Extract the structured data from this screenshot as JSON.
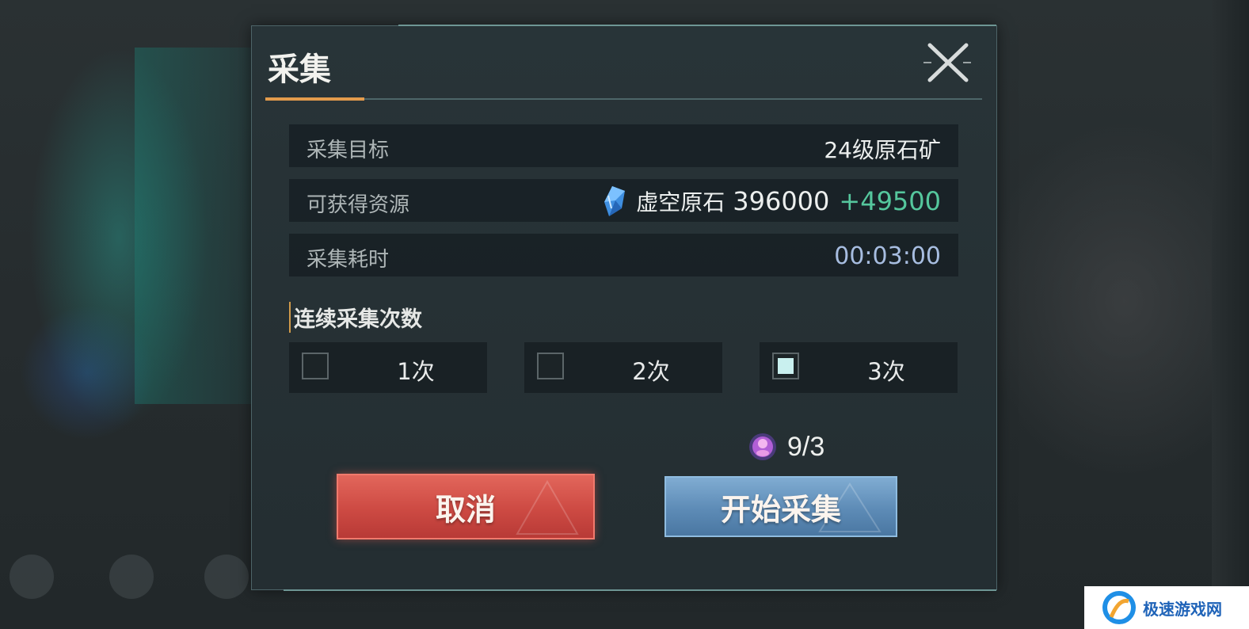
{
  "dialog": {
    "title": "采集",
    "close_icon": "close-x-icon"
  },
  "info_rows": {
    "target": {
      "label": "采集目标",
      "value": "24级原石矿"
    },
    "resource": {
      "label": "可获得资源",
      "icon": "crystal-icon",
      "name": "虚空原石",
      "amount": "396000",
      "bonus": "+49500"
    },
    "duration": {
      "label": "采集耗时",
      "value": "00:03:00"
    }
  },
  "repeat": {
    "title": "连续采集次数",
    "options": [
      {
        "label": "1次",
        "checked": false
      },
      {
        "label": "2次",
        "checked": false
      },
      {
        "label": "3次",
        "checked": true
      }
    ]
  },
  "cost": {
    "icon": "energy-orb-icon",
    "value": "9/3"
  },
  "buttons": {
    "cancel": "取消",
    "start": "开始采集"
  },
  "watermark": {
    "text": "极速游戏网"
  },
  "colors": {
    "accent_orange": "#e39b4c",
    "bonus_green": "#55c79d",
    "time_blue": "#a7bde0",
    "cancel_red": "#cd4a43",
    "start_blue": "#5d8bb6"
  }
}
